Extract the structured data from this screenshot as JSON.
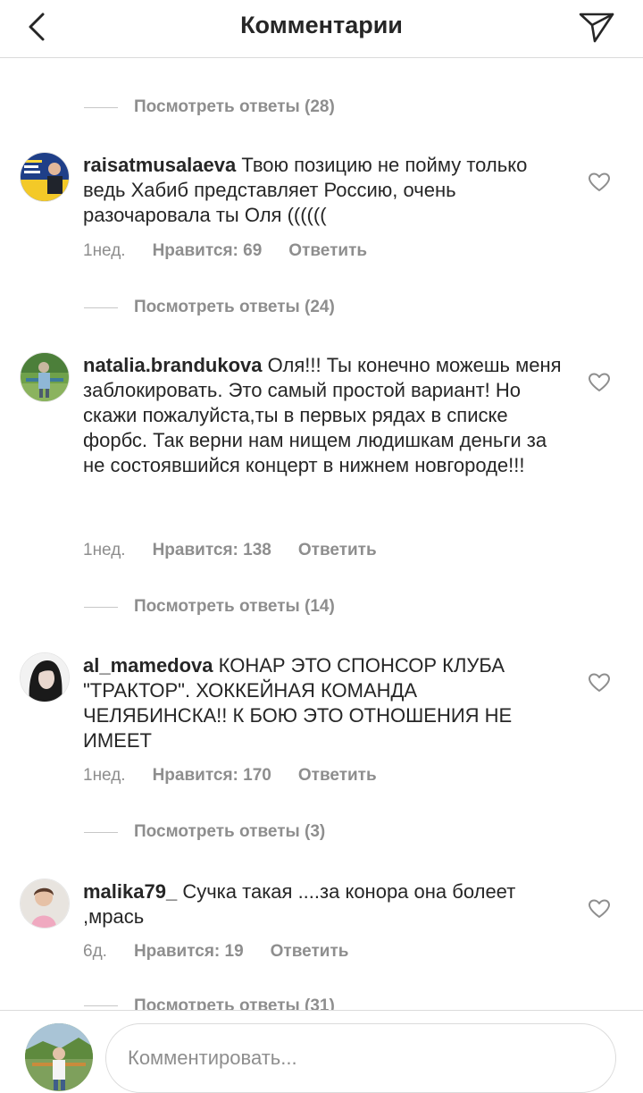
{
  "header": {
    "title": "Комментарии"
  },
  "replies_top": "Посмотреть ответы (28)",
  "comments": [
    {
      "username": "raisatmusalaeva",
      "text": "Твою позицию не пойму только ведь Хабиб представляет Россию, очень разочаровала ты Оля ((((((",
      "time": "1нед.",
      "likes": "Нравится: 69",
      "reply": "Ответить",
      "replies": "Посмотреть ответы (24)"
    },
    {
      "username": "natalia.brandukova",
      "text": "Оля!!! Ты конечно можешь меня заблокировать. Это самый простой вариант! Но скажи пожалуйста,ты в первых рядах в списке форбс. Так верни нам нищем людишкам деньги за не состоявшийся концерт в нижнем новгороде!!!",
      "time": "1нед.",
      "likes": "Нравится: 138",
      "reply": "Ответить",
      "replies": "Посмотреть ответы (14)"
    },
    {
      "username": "al_mamedova",
      "text": "КОНАР ЭТО СПОНСОР КЛУБА \"ТРАКТОР\". ХОККЕЙНАЯ КОМАНДА ЧЕЛЯБИНСКА!! К БОЮ ЭТО ОТНОШЕНИЯ НЕ ИМЕЕТ",
      "time": "1нед.",
      "likes": "Нравится: 170",
      "reply": "Ответить",
      "replies": "Посмотреть ответы (3)"
    },
    {
      "username": "malika79_",
      "text": "Сучка такая ....за конора она болеет ,мрась",
      "time": "6д.",
      "likes": "Нравится: 19",
      "reply": "Ответить",
      "replies": "Посмотреть ответы (31)"
    }
  ],
  "composer": {
    "placeholder": "Комментировать..."
  },
  "colors": {
    "text": "#262626",
    "secondary": "#8e8e8e",
    "border": "#dbdbdb"
  },
  "icons": [
    "back-arrow-icon",
    "direct-send-icon",
    "heart-icon"
  ]
}
